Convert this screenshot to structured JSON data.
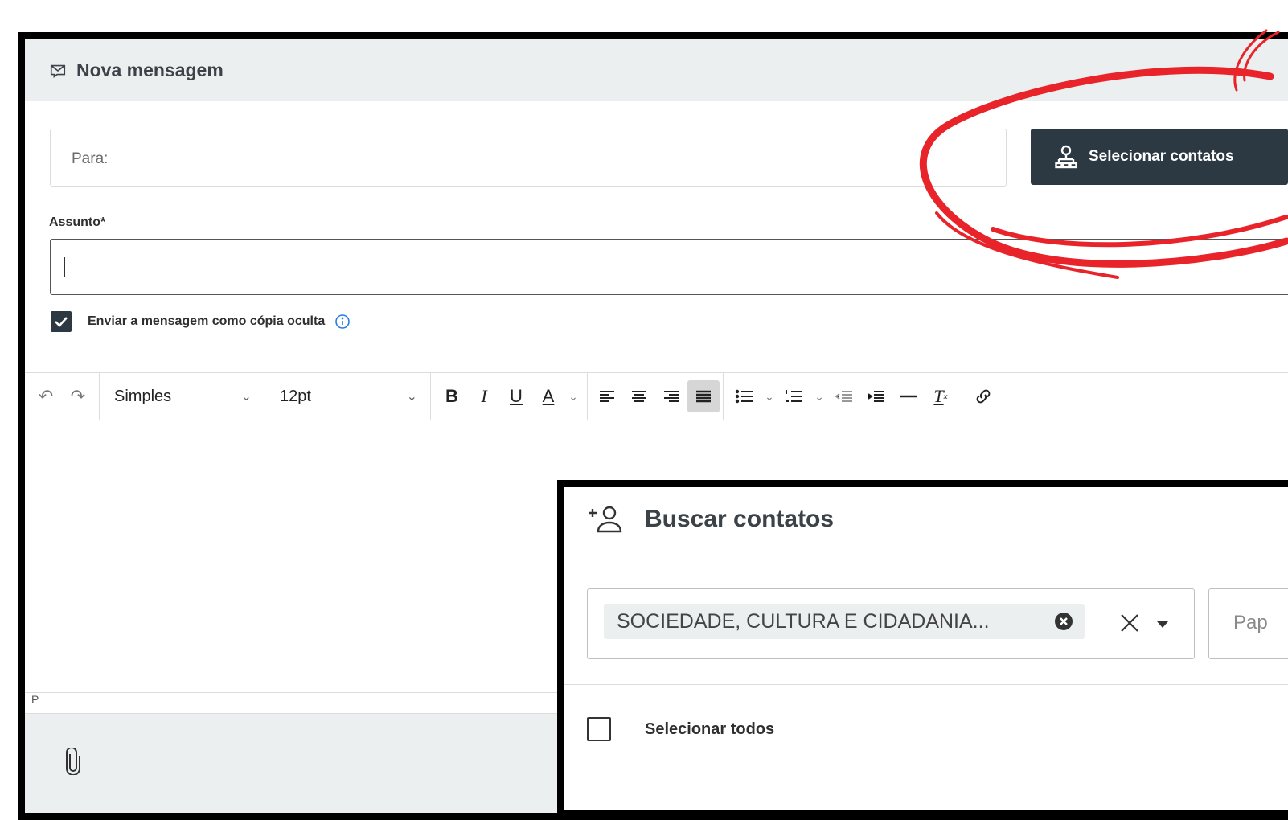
{
  "header": {
    "title": "Nova mensagem"
  },
  "to_field": {
    "placeholder": "Para:"
  },
  "select_contacts_button": {
    "label": "Selecionar contatos"
  },
  "subject": {
    "label": "Assunto*",
    "value": ""
  },
  "bcc": {
    "checked": true,
    "label": "Enviar a mensagem como cópia oculta"
  },
  "toolbar": {
    "style_value": "Simples",
    "size_value": "12pt",
    "bold": "B",
    "italic": "I",
    "underline": "U",
    "text_color": "A"
  },
  "status_bar": {
    "path": "P"
  },
  "dialog": {
    "title": "Buscar contatos",
    "filter_chip": "SOCIEDADE, CULTURA E CIDADANIA...",
    "role_placeholder": "Pap",
    "select_all_label": "Selecionar todos"
  },
  "annotation": {
    "color": "#e8242a"
  }
}
